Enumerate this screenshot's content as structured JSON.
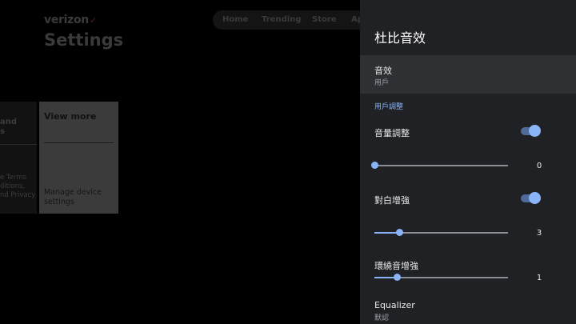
{
  "background": {
    "brand": "verizon",
    "brand_mark": "✓",
    "title": "Settings",
    "nav": [
      "Home",
      "Trending",
      "Store",
      "Ap"
    ],
    "left_card": {
      "heading": "and\ns",
      "text": "e Terms\nditions,\nnd Privacy"
    },
    "main_card": {
      "heading": "View more",
      "footer": "Manage device\nsettings"
    }
  },
  "panel": {
    "title": "杜比音效",
    "sound_effect": {
      "label": "音效",
      "value": "用戶"
    },
    "section_label": "用戶調整",
    "volume_leveler": {
      "label": "音量調整",
      "enabled": true,
      "value": "0",
      "fraction": 0.0
    },
    "dialogue_enhancer": {
      "label": "對白增強",
      "enabled": true,
      "value": "3",
      "fraction": 0.187
    },
    "surround_enhancer": {
      "label": "環繞音增強",
      "value": "1",
      "fraction": 0.168
    },
    "equalizer": {
      "label": "Equalizer",
      "value": "默認"
    }
  },
  "colors": {
    "panel_bg": "#202124",
    "accent": "#8ab4f8",
    "highlight": "#2f3033"
  }
}
